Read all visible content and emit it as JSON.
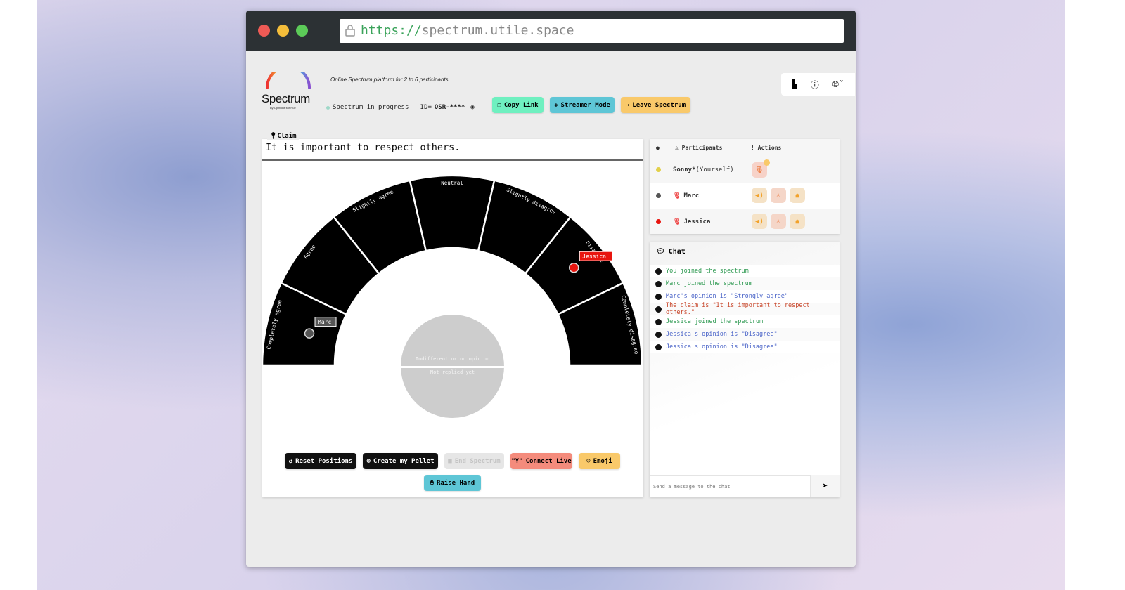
{
  "browser": {
    "url_scheme": "https://",
    "url_host": "spectrum.utile.space"
  },
  "header": {
    "logo_text": "Spectrum",
    "logo_byline": "By Opinions sur Rue",
    "tagline": "Online Spectrum platform for 2 to 6 participants",
    "status": "Spectrum in progress — ID=",
    "session_id": "OSR-****",
    "buttons": {
      "copy": "Copy Link",
      "streamer": "Streamer Mode",
      "leave": "Leave Spectrum"
    }
  },
  "claim": {
    "label": "Claim",
    "text": "It is important to respect others."
  },
  "spectrum": {
    "segments": [
      "Completely agree",
      "Agree",
      "Slightly agree",
      "Neutral",
      "Slightly disagree",
      "Disagree",
      "Completely disagree"
    ],
    "center_top": "Indifferent or no opinion",
    "center_bottom": "Not replied yet",
    "pellets": [
      {
        "name": "Marc",
        "color": "#555555",
        "opinion": "Completely agree"
      },
      {
        "name": "Jessica",
        "color": "#e8150f",
        "opinion": "Disagree"
      }
    ]
  },
  "controls": {
    "reset": "Reset Positions",
    "create": "Create my Pellet",
    "end": "End Spectrum",
    "connect": "Connect Live",
    "emoji": "Emoji",
    "raise": "Raise Hand"
  },
  "participants": {
    "header_name": "Participants",
    "header_actions": "! Actions",
    "rows": [
      {
        "name": "Sonny*",
        "suffix": " (Yourself)",
        "color": "#e2d04a"
      },
      {
        "name": "Marc",
        "color": "#555555"
      },
      {
        "name": "Jessica",
        "color": "#e8150f"
      }
    ]
  },
  "chat": {
    "title": "Chat",
    "placeholder": "Send a message to the chat",
    "messages": [
      {
        "text": "You joined the spectrum",
        "color": "#2f9a52"
      },
      {
        "text": "Marc joined the spectrum",
        "color": "#2f9a52"
      },
      {
        "text": "Marc's opinion is \"Strongly agree\"",
        "color": "#4a64c8"
      },
      {
        "text": "The claim is \"It is important to respect others.\"",
        "color": "#c8462a"
      },
      {
        "text": "Jessica joined the spectrum",
        "color": "#2f9a52"
      },
      {
        "text": "Jessica's opinion is \"Disagree\"",
        "color": "#4a64c8"
      },
      {
        "text": "Jessica's opinion is \"Disagree\"",
        "color": "#4a64c8"
      }
    ]
  }
}
